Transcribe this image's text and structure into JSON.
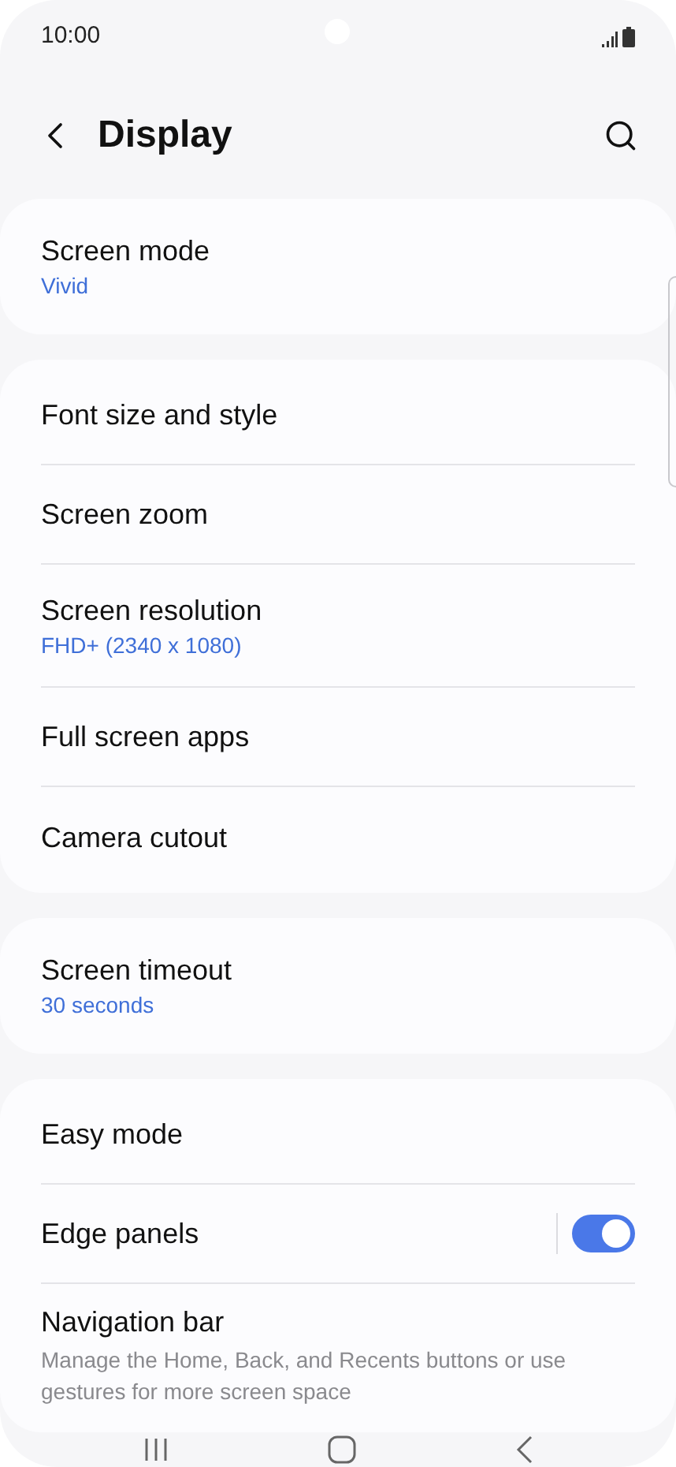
{
  "status_bar": {
    "time": "10:00"
  },
  "header": {
    "title": "Display"
  },
  "groups": [
    {
      "items": [
        {
          "kind": "link",
          "title": "Screen mode",
          "value": "Vivid"
        }
      ]
    },
    {
      "items": [
        {
          "kind": "link",
          "title": "Font size and style"
        },
        {
          "kind": "link",
          "title": "Screen zoom"
        },
        {
          "kind": "link",
          "title": "Screen resolution",
          "value": "FHD+ (2340 x 1080)"
        },
        {
          "kind": "link",
          "title": "Full screen apps"
        },
        {
          "kind": "link",
          "title": "Camera cutout"
        }
      ]
    },
    {
      "items": [
        {
          "kind": "link",
          "title": "Screen timeout",
          "value": "30 seconds"
        }
      ]
    },
    {
      "items": [
        {
          "kind": "link",
          "title": "Easy mode"
        },
        {
          "kind": "switch",
          "title": "Edge panels",
          "on": true
        },
        {
          "kind": "link",
          "title": "Navigation bar",
          "description": "Manage the Home, Back, and Recents buttons or use gestures for more screen space"
        }
      ]
    }
  ]
}
